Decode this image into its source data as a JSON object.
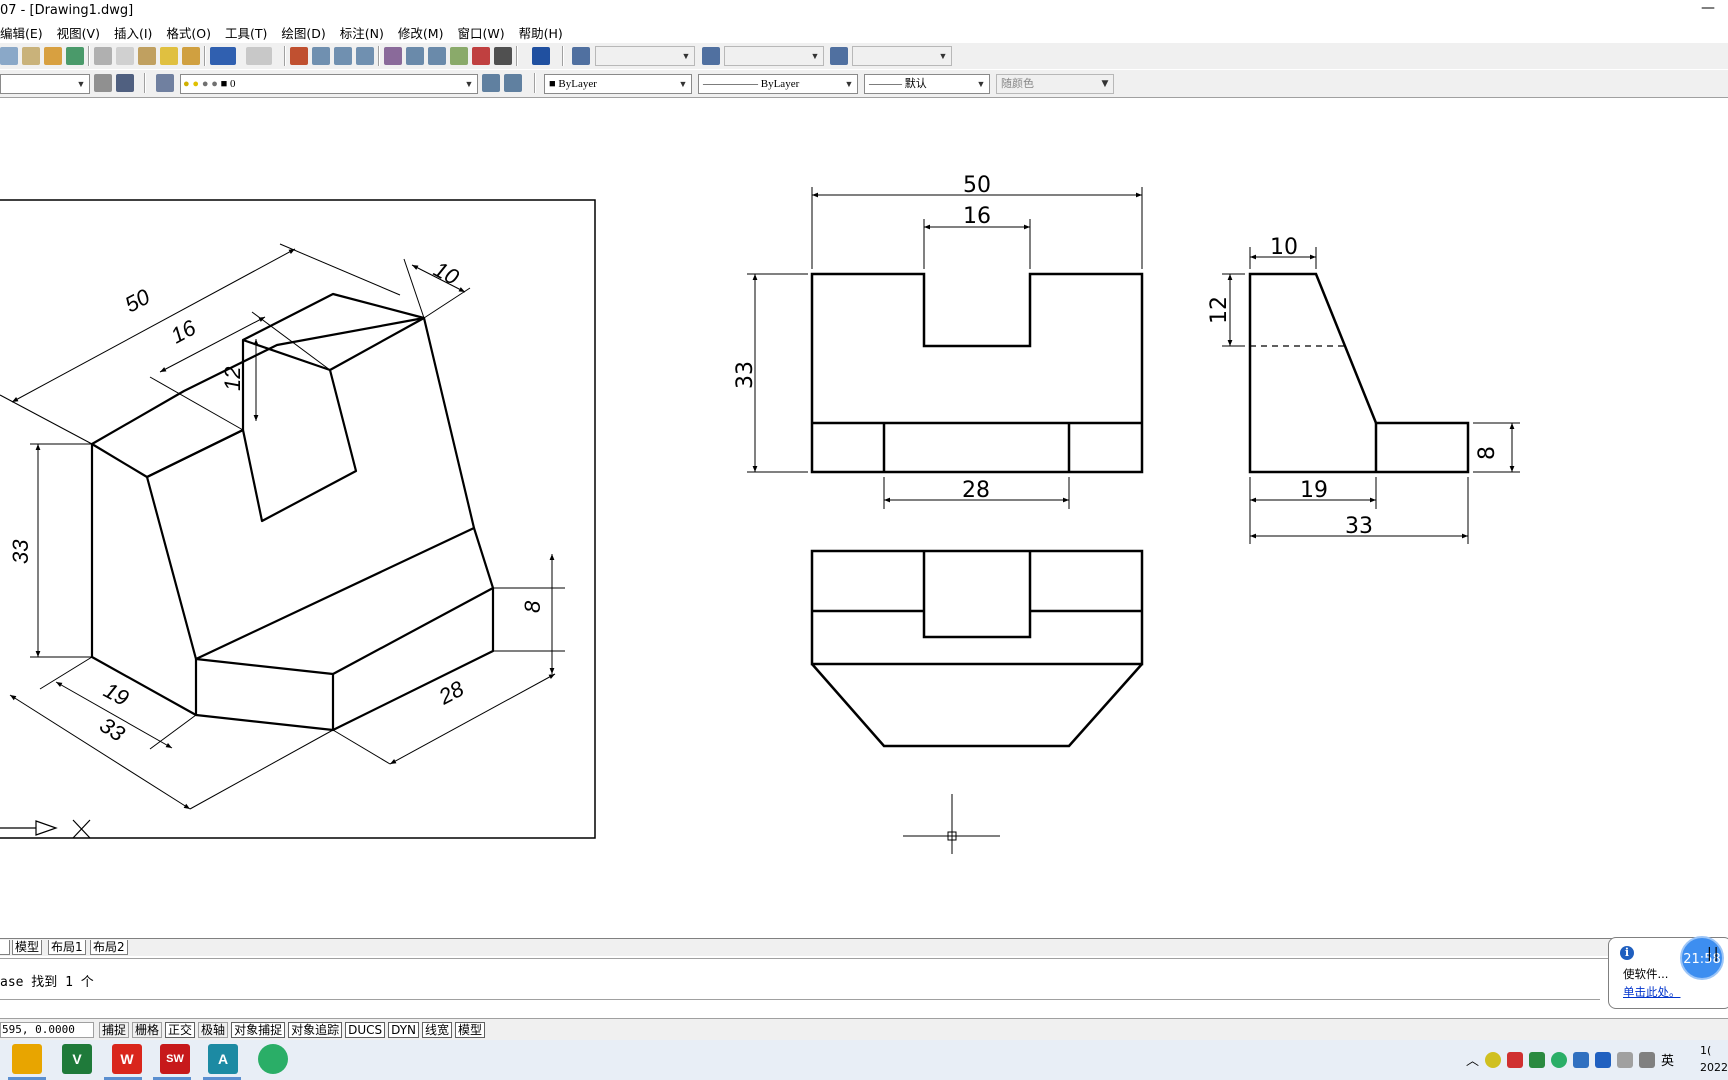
{
  "window": {
    "title": "07 - [Drawing1.dwg]",
    "minimize": "—"
  },
  "menu": [
    "编辑(E)",
    "视图(V)",
    "插入(I)",
    "格式(O)",
    "工具(T)",
    "绘图(D)",
    "标注(N)",
    "修改(M)",
    "窗口(W)",
    "帮助(H)"
  ],
  "toolbar2": {
    "layer_value": "0",
    "color_value": "ByLayer",
    "linetype_value": "ByLayer",
    "lineweight_value": "默认",
    "plotstyle_value": "随颜色"
  },
  "iso_dims": {
    "d50": "50",
    "d16": "16",
    "d10": "10",
    "d12": "12",
    "d33v": "33",
    "d8": "8",
    "d19": "19",
    "d33": "33",
    "d28": "28"
  },
  "front_dims": {
    "d50": "50",
    "d16": "16",
    "d33": "33",
    "d28": "28"
  },
  "side_dims": {
    "d10": "10",
    "d12": "12",
    "d8": "8",
    "d19": "19",
    "d33": "33"
  },
  "layout_tabs": [
    "模型",
    "布局1",
    "布局2"
  ],
  "command": {
    "line1": "ase 找到 1 个"
  },
  "status": {
    "coords": "595, 0.0000",
    "toggles": [
      {
        "label": "捕捉",
        "on": false
      },
      {
        "label": "栅格",
        "on": false
      },
      {
        "label": "正交",
        "on": true
      },
      {
        "label": "极轴",
        "on": false
      },
      {
        "label": "对象捕捉",
        "on": true
      },
      {
        "label": "对象追踪",
        "on": true
      },
      {
        "label": "DUCS",
        "on": true
      },
      {
        "label": "DYN",
        "on": true
      },
      {
        "label": "线宽",
        "on": true
      },
      {
        "label": "模型",
        "on": true
      }
    ]
  },
  "balloon": {
    "line1": "使软件...",
    "link": "单击此处。"
  },
  "timer": {
    "text": "21:58",
    "pause": "||"
  },
  "taskbar": {
    "apps": [
      {
        "name": "file-explorer",
        "label": "",
        "color": "#e8a500"
      },
      {
        "name": "app-v",
        "label": "V",
        "color": "#1f7a3a"
      },
      {
        "name": "wps",
        "label": "W",
        "color": "#d9261c"
      },
      {
        "name": "solidworks",
        "label": "SW",
        "color": "#c7191b"
      },
      {
        "name": "autocad",
        "label": "A",
        "color": "#1c8aa3"
      },
      {
        "name": "wechat",
        "label": "",
        "color": "#2aae67"
      }
    ],
    "ime": "英",
    "clock_line1": "1(",
    "clock_line2": "2022"
  },
  "colors": {
    "toolbar_bg": "#f0f0f0",
    "link": "#0033cc",
    "timer": "#3d8ef0"
  }
}
